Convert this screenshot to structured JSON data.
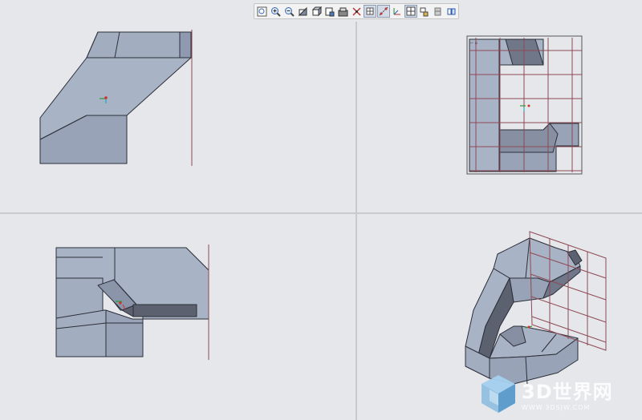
{
  "toolbar": {
    "buttons": [
      {
        "icon": "refit-icon"
      },
      {
        "icon": "zoom-in-icon"
      },
      {
        "icon": "zoom-out-icon"
      },
      {
        "icon": "reorient-icon"
      },
      {
        "icon": "saved-views-icon"
      },
      {
        "icon": "display-style-icon"
      },
      {
        "icon": "view-manager-icon"
      },
      {
        "icon": "plane-display-icon"
      },
      {
        "icon": "axis-display-icon"
      },
      {
        "icon": "point-display-icon"
      },
      {
        "icon": "csys-display-icon"
      },
      {
        "icon": "layout-grid-icon"
      },
      {
        "icon": "annotation-display-icon"
      },
      {
        "icon": "spin-center-icon"
      },
      {
        "icon": "section-icon"
      }
    ],
    "active_indices": [
      8,
      9,
      11
    ]
  },
  "colors": {
    "background": "#e6e7eb",
    "part_face_light": "#a9b3c6",
    "part_face_mid": "#98a3b7",
    "part_face_dark": "#5c6170",
    "edge": "#2b2f38",
    "datum_grid": "#8e4a55"
  },
  "viewports": {
    "top_left": {
      "name": "view-top-left"
    },
    "top_right": {
      "name": "view-top-right"
    },
    "bottom_left": {
      "name": "view-bottom-left"
    },
    "bottom_right": {
      "name": "view-bottom-right"
    }
  },
  "watermark": {
    "title": "3D世界网",
    "url": "WWW.3DSJW.COM"
  }
}
